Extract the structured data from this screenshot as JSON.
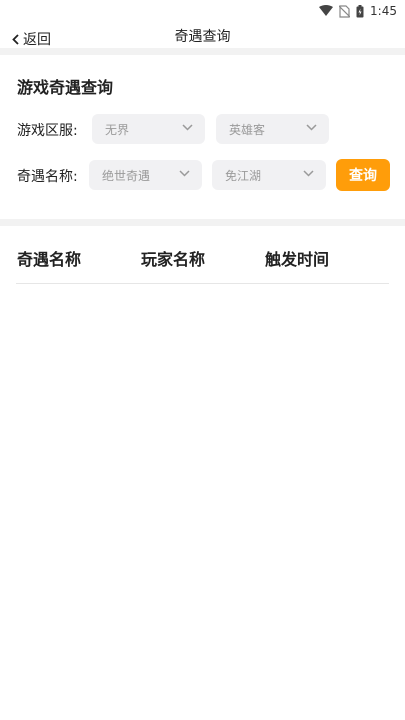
{
  "status_bar": {
    "time": "1:45"
  },
  "nav": {
    "back_label": "返回",
    "title": "奇遇查询"
  },
  "section": {
    "title": "游戏奇遇查询"
  },
  "filters": {
    "server_label": "游戏区服:",
    "server_primary": "无界",
    "server_secondary": "英雄客",
    "encounter_label": "奇遇名称:",
    "encounter_primary": "绝世奇遇",
    "encounter_secondary": "免江湖",
    "query_label": "查询"
  },
  "table": {
    "headers": [
      "奇遇名称",
      "玩家名称",
      "触发时间"
    ],
    "rows": []
  },
  "colors": {
    "accent": "#ff9d0a",
    "select_bg": "#f1f1f3",
    "band": "#f2f2f2"
  }
}
